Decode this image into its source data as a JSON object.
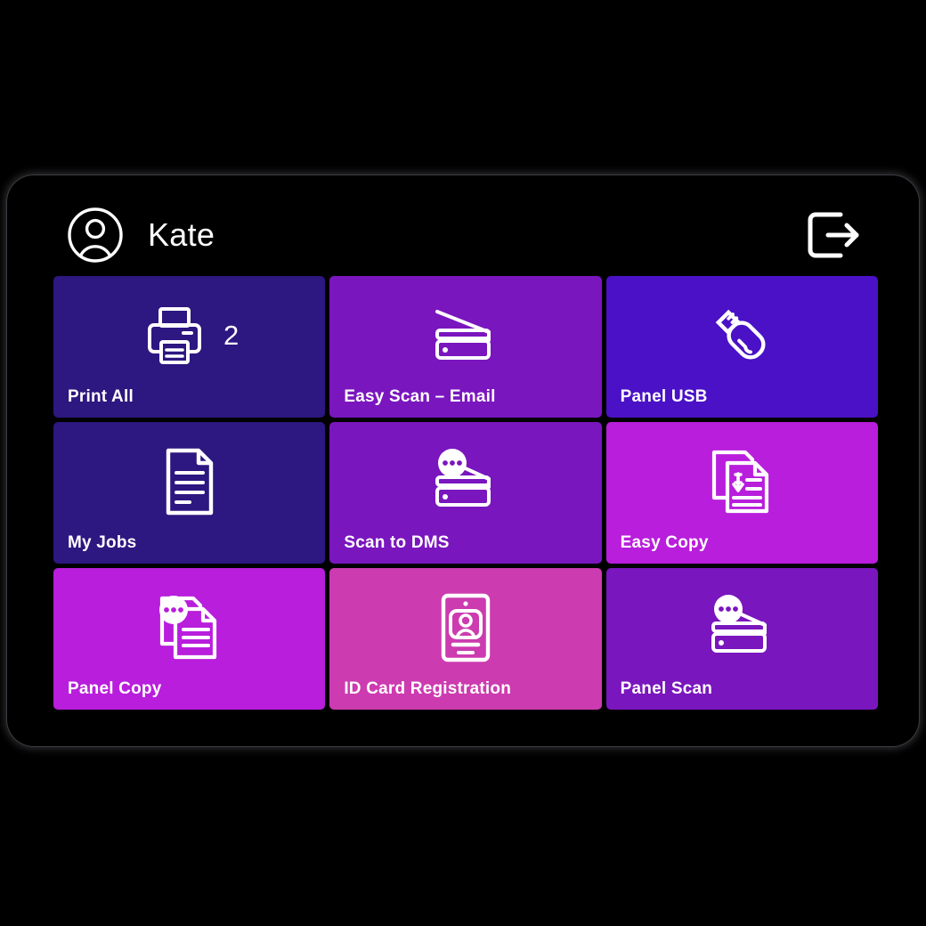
{
  "device": {
    "frame_color": "#000000",
    "screen_background": "#000000"
  },
  "header": {
    "avatar_icon": "user-circle-icon",
    "user_name": "Kate",
    "logout_icon": "logout-icon"
  },
  "grid": {
    "columns": 3,
    "rows": 3,
    "tiles": [
      {
        "id": "print-all",
        "label": "Print All",
        "icon": "printer-icon",
        "badge": "2",
        "color": "#2D1780"
      },
      {
        "id": "easy-scan-email",
        "label": "Easy Scan – Email",
        "icon": "scanner-icon",
        "badge": "",
        "color": "#7A16BE"
      },
      {
        "id": "panel-usb",
        "label": "Panel USB",
        "icon": "usb-drive-icon",
        "badge": "",
        "color": "#4A11C6"
      },
      {
        "id": "my-jobs",
        "label": "My Jobs",
        "icon": "document-icon",
        "badge": "",
        "color": "#2D1780"
      },
      {
        "id": "scan-to-dms",
        "label": "Scan to DMS",
        "icon": "scanner-ellipsis-icon",
        "badge": "",
        "color": "#7A16BE"
      },
      {
        "id": "easy-copy",
        "label": "Easy Copy",
        "icon": "copy-documents-icon",
        "badge": "",
        "color": "#B81EDC"
      },
      {
        "id": "panel-copy",
        "label": "Panel Copy",
        "icon": "copy-documents-ellipsis-icon",
        "badge": "",
        "color": "#B81EDC"
      },
      {
        "id": "id-card-registration",
        "label": "ID Card Registration",
        "icon": "id-card-icon",
        "badge": "",
        "color": "#CC3BAF"
      },
      {
        "id": "panel-scan",
        "label": "Panel Scan",
        "icon": "scanner-ellipsis-icon",
        "badge": "",
        "color": "#7A16BE"
      }
    ]
  }
}
